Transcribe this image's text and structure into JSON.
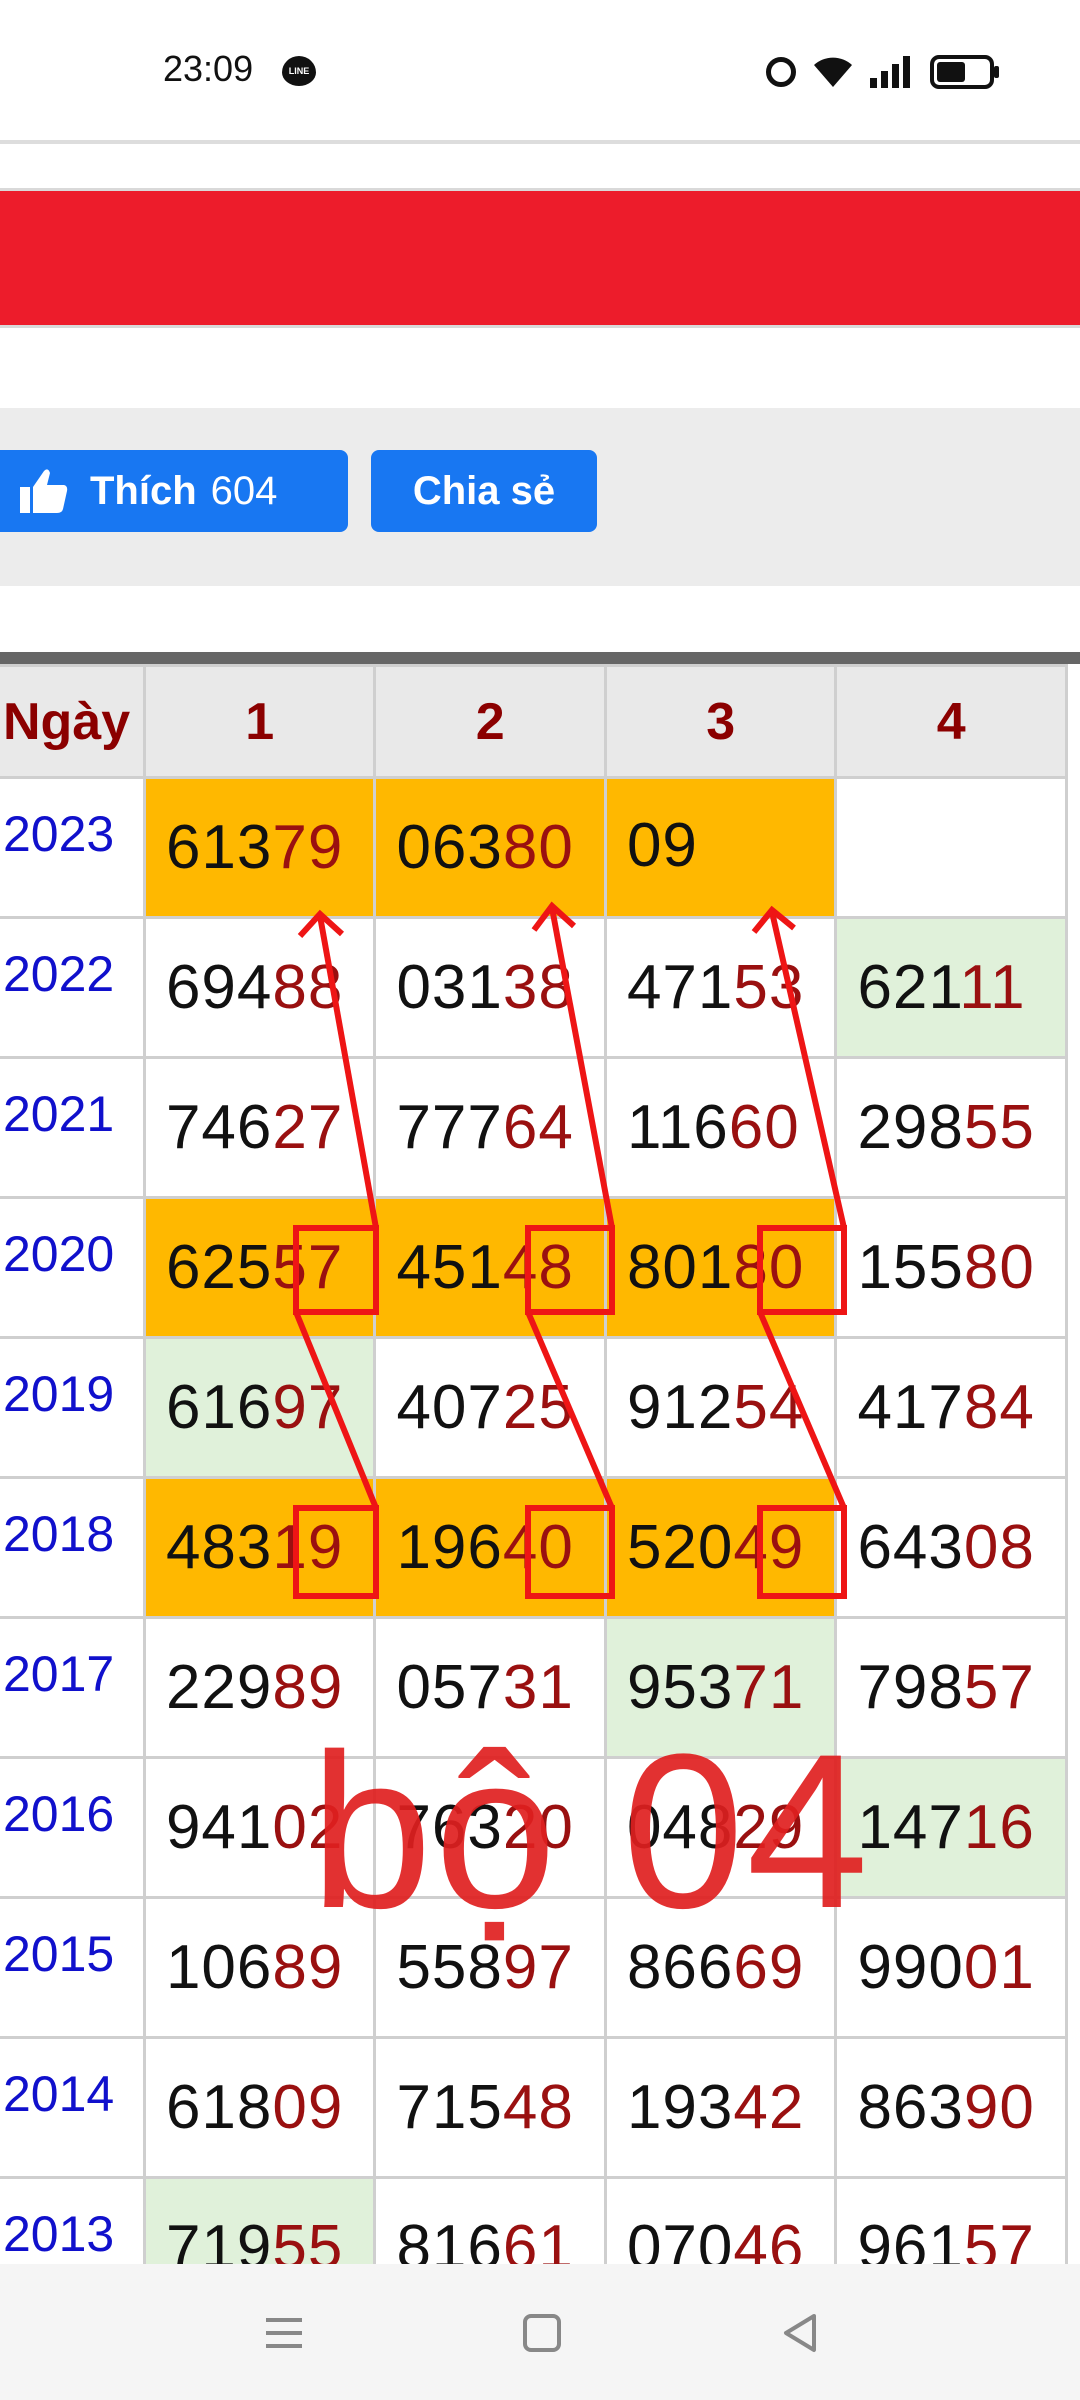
{
  "status": {
    "time": "23:09",
    "line_icon": "line-icon",
    "icons": [
      "alarm-icon",
      "wifi-icon",
      "signal-icon",
      "battery-icon"
    ]
  },
  "share": {
    "like_label": "Thích",
    "like_count": "604",
    "share_label": "Chia sẻ"
  },
  "table": {
    "header": [
      "Ngày",
      "1",
      "2",
      "3",
      "4"
    ],
    "rows": [
      {
        "year": "2023",
        "cells": [
          {
            "head": "613",
            "tail": "79",
            "bg": "gold"
          },
          {
            "head": "063",
            "tail": "80",
            "bg": "gold"
          },
          {
            "head": "",
            "tail": "",
            "bg": "gold",
            "big": "09"
          },
          {
            "head": "",
            "tail": "",
            "bg": "white"
          }
        ]
      },
      {
        "year": "2022",
        "cells": [
          {
            "head": "694",
            "tail": "88",
            "bg": "white"
          },
          {
            "head": "031",
            "tail": "38",
            "bg": "white"
          },
          {
            "head": "471",
            "tail": "53",
            "bg": "white"
          },
          {
            "head": "621",
            "tail": "11",
            "bg": "green"
          }
        ]
      },
      {
        "year": "2021",
        "cells": [
          {
            "head": "746",
            "tail": "27",
            "bg": "white"
          },
          {
            "head": "777",
            "tail": "64",
            "bg": "white"
          },
          {
            "head": "116",
            "tail": "60",
            "bg": "white"
          },
          {
            "head": "298",
            "tail": "55",
            "bg": "white"
          }
        ]
      },
      {
        "year": "2020",
        "cells": [
          {
            "head": "625",
            "tail": "57",
            "bg": "gold"
          },
          {
            "head": "451",
            "tail": "48",
            "bg": "gold"
          },
          {
            "head": "801",
            "tail": "80",
            "bg": "gold"
          },
          {
            "head": "155",
            "tail": "80",
            "bg": "white"
          }
        ]
      },
      {
        "year": "2019",
        "cells": [
          {
            "head": "616",
            "tail": "97",
            "bg": "green"
          },
          {
            "head": "407",
            "tail": "25",
            "bg": "white"
          },
          {
            "head": "912",
            "tail": "54",
            "bg": "white"
          },
          {
            "head": "417",
            "tail": "84",
            "bg": "white"
          }
        ]
      },
      {
        "year": "2018",
        "cells": [
          {
            "head": "483",
            "tail": "19",
            "bg": "gold"
          },
          {
            "head": "196",
            "tail": "40",
            "bg": "gold"
          },
          {
            "head": "520",
            "tail": "49",
            "bg": "gold"
          },
          {
            "head": "643",
            "tail": "08",
            "bg": "white"
          }
        ]
      },
      {
        "year": "2017",
        "cells": [
          {
            "head": "229",
            "tail": "89",
            "bg": "white"
          },
          {
            "head": "057",
            "tail": "31",
            "bg": "white"
          },
          {
            "head": "953",
            "tail": "71",
            "bg": "green"
          },
          {
            "head": "798",
            "tail": "57",
            "bg": "white"
          }
        ]
      },
      {
        "year": "2016",
        "cells": [
          {
            "head": "941",
            "tail": "02",
            "bg": "white"
          },
          {
            "head": "763",
            "tail": "20",
            "bg": "white"
          },
          {
            "head": "048",
            "tail": "29",
            "bg": "white"
          },
          {
            "head": "147",
            "tail": "16",
            "bg": "green"
          }
        ]
      },
      {
        "year": "2015",
        "cells": [
          {
            "head": "106",
            "tail": "89",
            "bg": "white"
          },
          {
            "head": "558",
            "tail": "97",
            "bg": "white"
          },
          {
            "head": "866",
            "tail": "69",
            "bg": "white"
          },
          {
            "head": "990",
            "tail": "01",
            "bg": "white"
          }
        ]
      },
      {
        "year": "2014",
        "cells": [
          {
            "head": "618",
            "tail": "09",
            "bg": "white"
          },
          {
            "head": "715",
            "tail": "48",
            "bg": "white"
          },
          {
            "head": "193",
            "tail": "42",
            "bg": "white"
          },
          {
            "head": "863",
            "tail": "90",
            "bg": "white"
          }
        ]
      },
      {
        "year": "2013",
        "cells": [
          {
            "head": "719",
            "tail": "55",
            "bg": "green"
          },
          {
            "head": "816",
            "tail": "61",
            "bg": "white"
          },
          {
            "head": "070",
            "tail": "46",
            "bg": "white"
          },
          {
            "head": "961",
            "tail": "57",
            "bg": "white"
          }
        ]
      }
    ]
  },
  "annotation": {
    "text": "bộ 04",
    "color": "#e02020"
  },
  "colors": {
    "banner": "#ed1c2b",
    "facebook": "#1877f2",
    "gold": "#ffb800",
    "green": "#e0f1da",
    "year": "#1010cc",
    "tail": "#9a1010"
  },
  "nav": [
    "menu-icon",
    "home-icon",
    "back-icon"
  ]
}
